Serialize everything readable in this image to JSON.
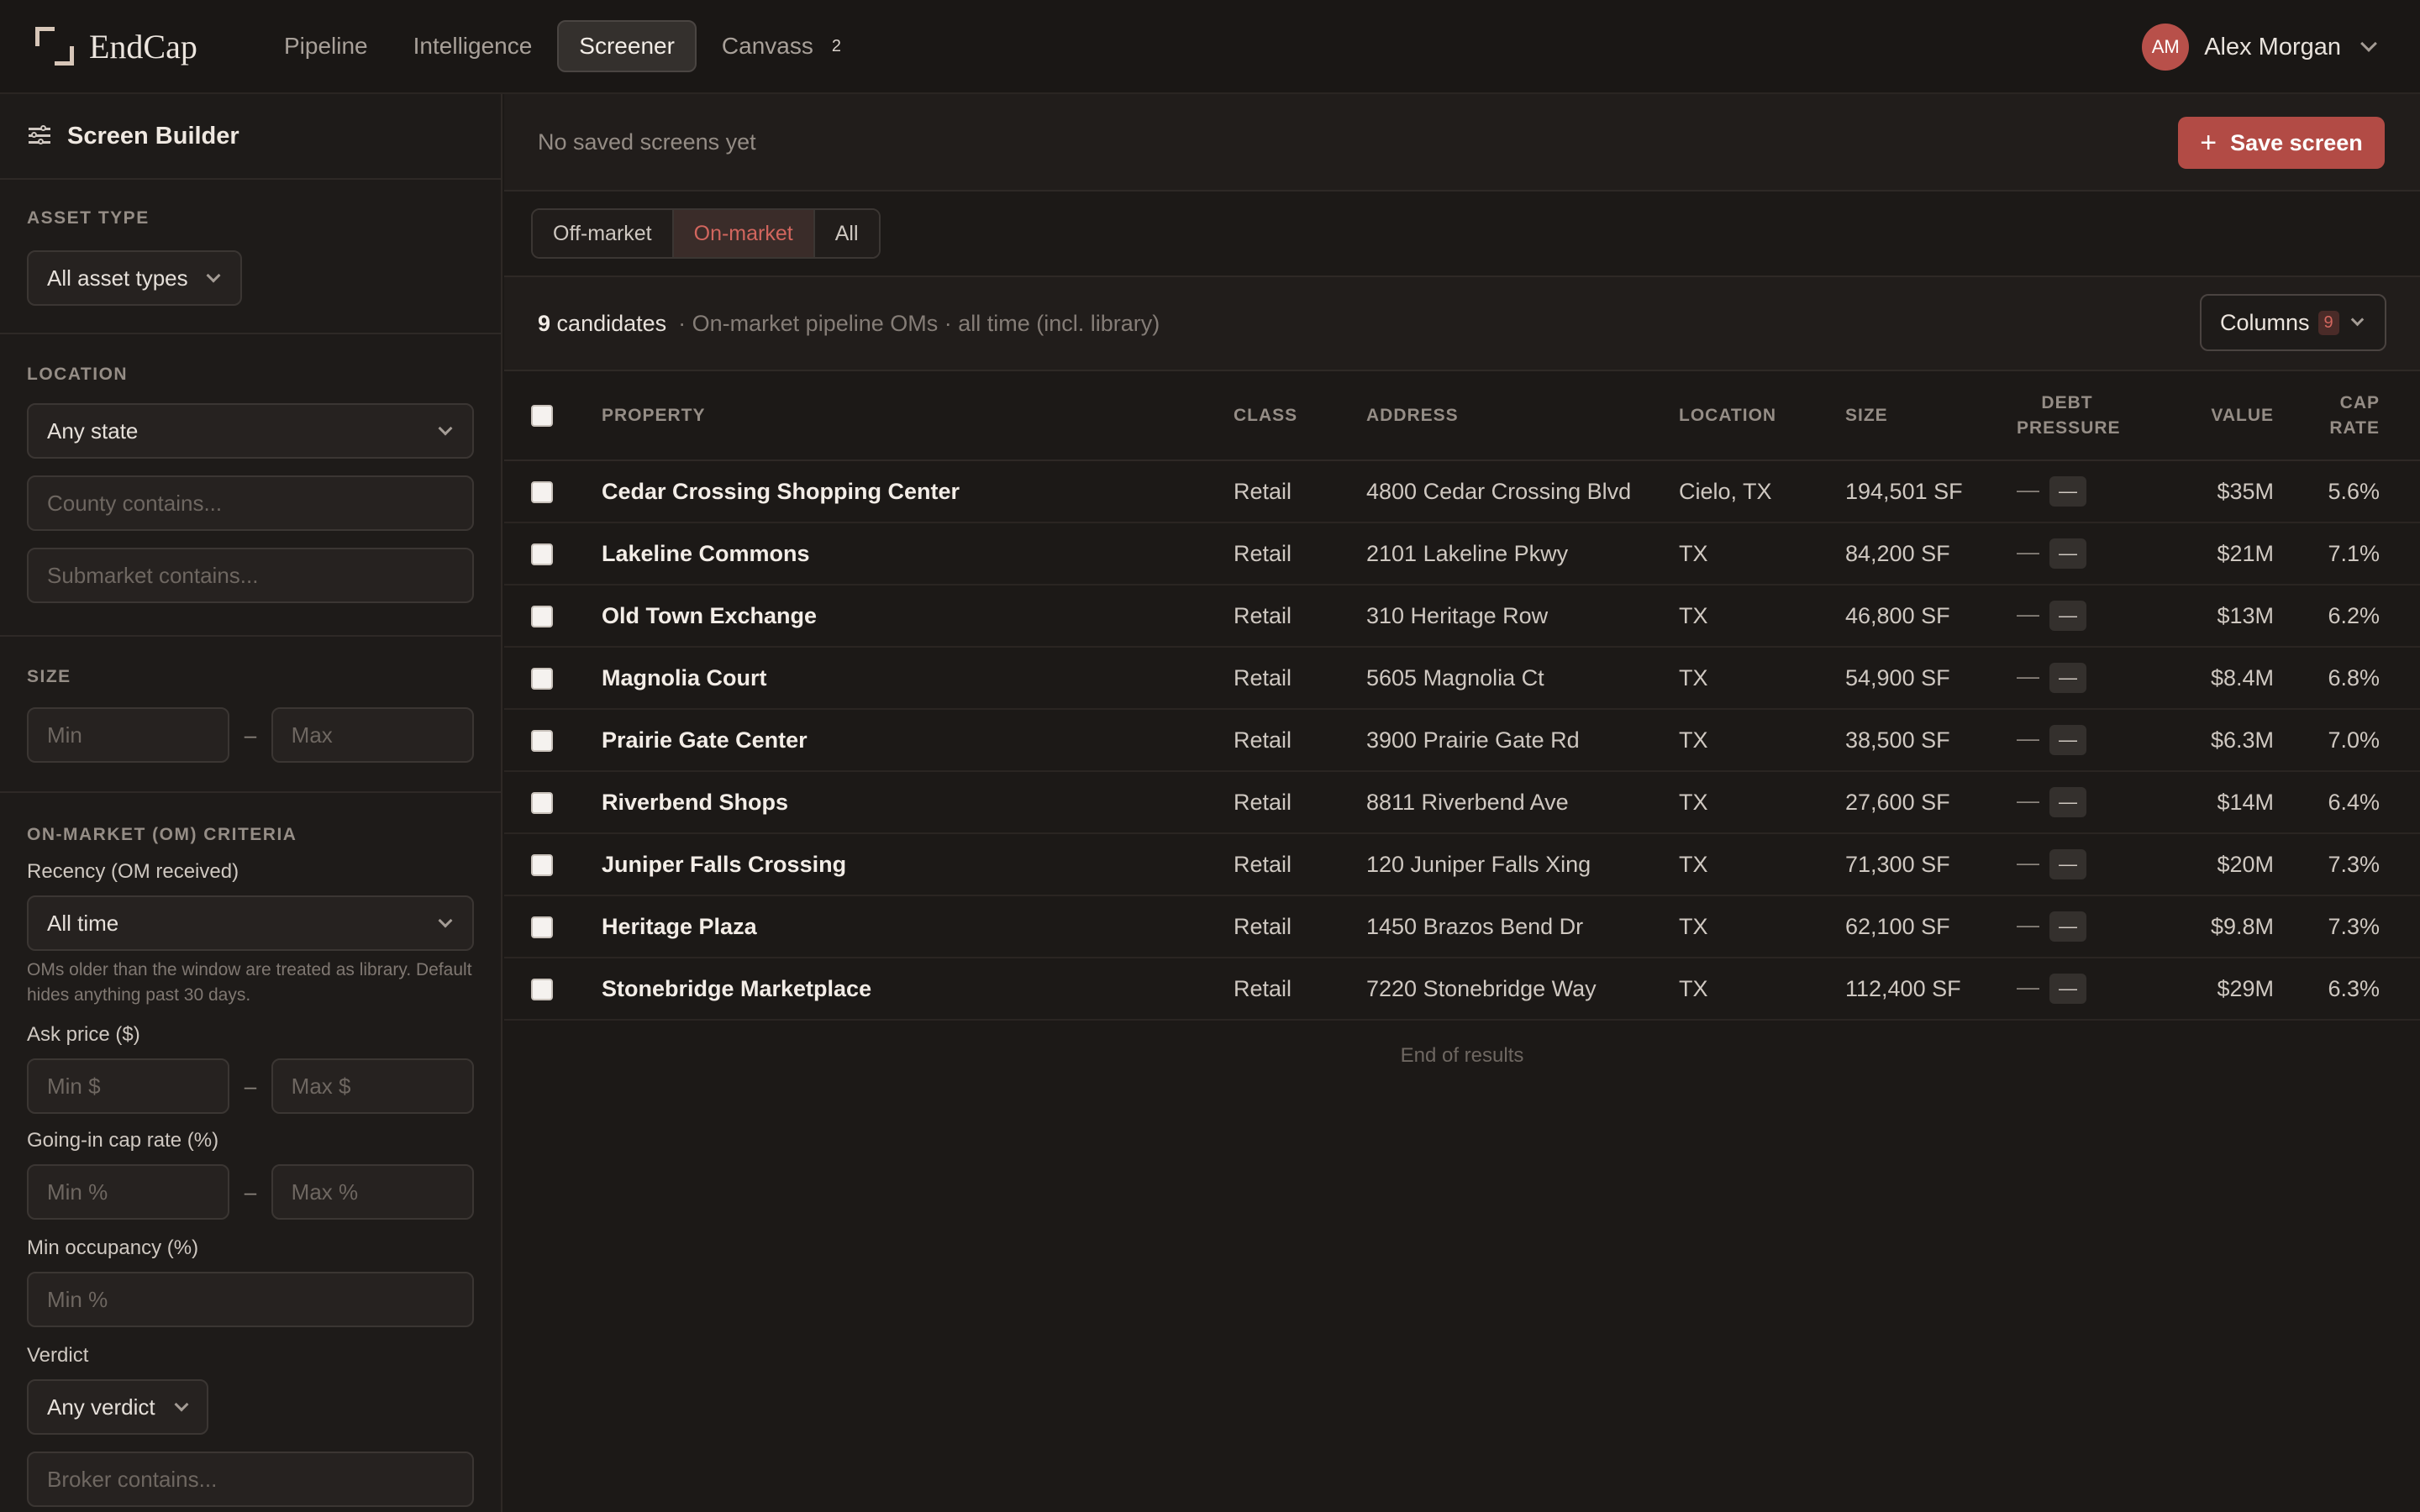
{
  "brand": {
    "name": "EndCap"
  },
  "nav": {
    "tabs": [
      {
        "label": "Pipeline",
        "active": false
      },
      {
        "label": "Intelligence",
        "active": false
      },
      {
        "label": "Screener",
        "active": true
      },
      {
        "label": "Canvass",
        "active": false,
        "badge": "2"
      }
    ]
  },
  "user": {
    "initials": "AM",
    "name": "Alex Morgan",
    "avatar_color": "#b8504a"
  },
  "sidebar": {
    "title": "Screen Builder",
    "asset_type": {
      "label": "ASSET TYPE",
      "value": "All asset types"
    },
    "location": {
      "label": "LOCATION",
      "state": "Any state",
      "county_placeholder": "County contains...",
      "submarket_placeholder": "Submarket contains..."
    },
    "size": {
      "label": "SIZE",
      "min_placeholder": "Min",
      "max_placeholder": "Max",
      "dash": "–"
    },
    "om": {
      "label": "ON-MARKET (OM) CRITERIA",
      "recency_label": "Recency (OM received)",
      "recency_value": "All time",
      "recency_hint": "OMs older than the window are treated as library. Default hides anything past 30 days.",
      "ask_label": "Ask price ($)",
      "ask_min": "Min $",
      "ask_max": "Max $",
      "cap_label": "Going-in cap rate (%)",
      "cap_min": "Min %",
      "cap_max": "Max %",
      "occ_label": "Min occupancy (%)",
      "occ_min": "Min %",
      "verdict_label": "Verdict",
      "verdict_value": "Any verdict",
      "broker_placeholder": "Broker contains..."
    }
  },
  "main": {
    "saved_text": "No saved screens yet",
    "save_button": "Save screen",
    "segments": [
      {
        "label": "Off-market",
        "active": false
      },
      {
        "label": "On-market",
        "active": true
      },
      {
        "label": "All",
        "active": false
      }
    ],
    "summary": {
      "count": "9",
      "count_label": "candidates",
      "meta": "· On-market pipeline OMs · all time (incl. library)"
    },
    "columns_button": {
      "label": "Columns",
      "badge": "9"
    },
    "table": {
      "headers": {
        "property": "PROPERTY",
        "class": "CLASS",
        "address": "ADDRESS",
        "location": "LOCATION",
        "size": "SIZE",
        "debt_line1": "DEBT",
        "debt_line2": "PRESSURE",
        "value": "VALUE",
        "cap_line1": "CAP",
        "cap_line2": "RATE"
      },
      "rows": [
        {
          "property": "Cedar Crossing Shopping Center",
          "class": "Retail",
          "address": "4800 Cedar Crossing Blvd",
          "location": "Cielo, TX",
          "size": "194,501 SF",
          "debt": "—",
          "debt_chip": "—",
          "value": "$35M",
          "cap": "5.6%"
        },
        {
          "property": "Lakeline Commons",
          "class": "Retail",
          "address": "2101 Lakeline Pkwy",
          "location": "TX",
          "size": "84,200 SF",
          "debt": "—",
          "debt_chip": "—",
          "value": "$21M",
          "cap": "7.1%"
        },
        {
          "property": "Old Town Exchange",
          "class": "Retail",
          "address": "310 Heritage Row",
          "location": "TX",
          "size": "46,800 SF",
          "debt": "—",
          "debt_chip": "—",
          "value": "$13M",
          "cap": "6.2%"
        },
        {
          "property": "Magnolia Court",
          "class": "Retail",
          "address": "5605 Magnolia Ct",
          "location": "TX",
          "size": "54,900 SF",
          "debt": "—",
          "debt_chip": "—",
          "value": "$8.4M",
          "cap": "6.8%"
        },
        {
          "property": "Prairie Gate Center",
          "class": "Retail",
          "address": "3900 Prairie Gate Rd",
          "location": "TX",
          "size": "38,500 SF",
          "debt": "—",
          "debt_chip": "—",
          "value": "$6.3M",
          "cap": "7.0%"
        },
        {
          "property": "Riverbend Shops",
          "class": "Retail",
          "address": "8811 Riverbend Ave",
          "location": "TX",
          "size": "27,600 SF",
          "debt": "—",
          "debt_chip": "—",
          "value": "$14M",
          "cap": "6.4%"
        },
        {
          "property": "Juniper Falls Crossing",
          "class": "Retail",
          "address": "120 Juniper Falls Xing",
          "location": "TX",
          "size": "71,300 SF",
          "debt": "—",
          "debt_chip": "—",
          "value": "$20M",
          "cap": "7.3%"
        },
        {
          "property": "Heritage Plaza",
          "class": "Retail",
          "address": "1450 Brazos Bend Dr",
          "location": "TX",
          "size": "62,100 SF",
          "debt": "—",
          "debt_chip": "—",
          "value": "$9.8M",
          "cap": "7.3%"
        },
        {
          "property": "Stonebridge Marketplace",
          "class": "Retail",
          "address": "7220 Stonebridge Way",
          "location": "TX",
          "size": "112,400 SF",
          "debt": "—",
          "debt_chip": "—",
          "value": "$29M",
          "cap": "6.3%"
        }
      ],
      "end_text": "End of results"
    }
  },
  "colors": {
    "accent": "#b24b45",
    "accent_text": "#d2665e",
    "background": "#1c1917"
  }
}
